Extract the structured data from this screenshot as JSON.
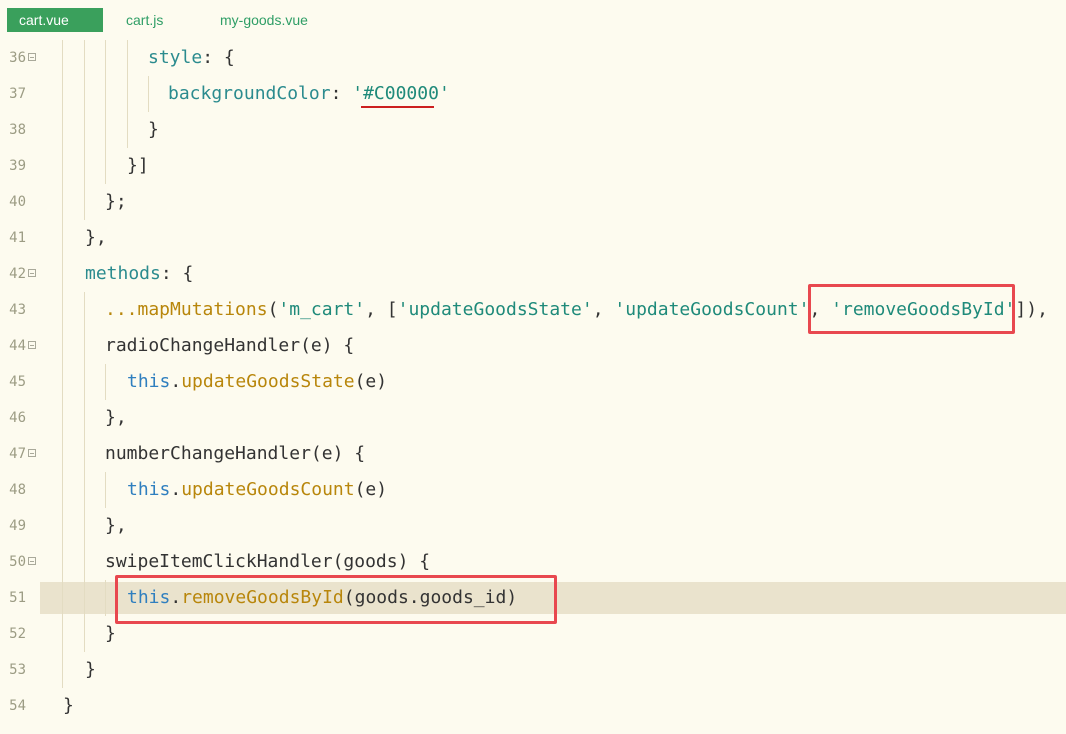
{
  "tabs": [
    {
      "label": "cart.vue",
      "active": true
    },
    {
      "label": "cart.js",
      "active": false
    },
    {
      "label": "my-goods.vue",
      "active": false
    }
  ],
  "colors": {
    "background": "#fdfbef",
    "active_tab": "#3aa05c",
    "highlight_box": "#e8484f",
    "current_line": "#eae3cd"
  },
  "lines": [
    {
      "num": "36",
      "fold": true,
      "tokens": [
        [
          "kw",
          "style"
        ],
        [
          "plain",
          ": {"
        ]
      ]
    },
    {
      "num": "37",
      "fold": false,
      "tokens": [
        [
          "kw",
          "backgroundColor"
        ],
        [
          "plain",
          ": "
        ],
        [
          "str",
          "'#C00000'"
        ]
      ]
    },
    {
      "num": "38",
      "fold": false,
      "tokens": [
        [
          "plain",
          "}"
        ]
      ]
    },
    {
      "num": "39",
      "fold": false,
      "tokens": [
        [
          "plain",
          "}]"
        ]
      ]
    },
    {
      "num": "40",
      "fold": false,
      "tokens": [
        [
          "plain",
          "};"
        ]
      ]
    },
    {
      "num": "41",
      "fold": false,
      "tokens": [
        [
          "plain",
          "},"
        ]
      ]
    },
    {
      "num": "42",
      "fold": true,
      "tokens": [
        [
          "kw",
          "methods"
        ],
        [
          "plain",
          ": {"
        ]
      ]
    },
    {
      "num": "43",
      "fold": false,
      "tokens": [
        [
          "fn",
          "...mapMutations"
        ],
        [
          "plain",
          "("
        ],
        [
          "str",
          "'m_cart'"
        ],
        [
          "plain",
          ", ["
        ],
        [
          "str",
          "'updateGoodsState'"
        ],
        [
          "plain",
          ", "
        ],
        [
          "str",
          "'updateGoodsCount'"
        ],
        [
          "plain",
          ", "
        ],
        [
          "str",
          "'removeGoodsById'"
        ],
        [
          "plain",
          "]),"
        ]
      ]
    },
    {
      "num": "44",
      "fold": true,
      "tokens": [
        [
          "plain",
          "radioChangeHandler(e) {"
        ]
      ]
    },
    {
      "num": "45",
      "fold": false,
      "tokens": [
        [
          "thiskw",
          "this"
        ],
        [
          "plain",
          "."
        ],
        [
          "fn",
          "updateGoodsState"
        ],
        [
          "plain",
          "(e)"
        ]
      ]
    },
    {
      "num": "46",
      "fold": false,
      "tokens": [
        [
          "plain",
          "},"
        ]
      ]
    },
    {
      "num": "47",
      "fold": true,
      "tokens": [
        [
          "plain",
          "numberChangeHandler(e) {"
        ]
      ]
    },
    {
      "num": "48",
      "fold": false,
      "tokens": [
        [
          "thiskw",
          "this"
        ],
        [
          "plain",
          "."
        ],
        [
          "fn",
          "updateGoodsCount"
        ],
        [
          "plain",
          "(e)"
        ]
      ]
    },
    {
      "num": "49",
      "fold": false,
      "tokens": [
        [
          "plain",
          "},"
        ]
      ]
    },
    {
      "num": "50",
      "fold": true,
      "tokens": [
        [
          "plain",
          "swipeItemClickHandler(goods) {"
        ]
      ]
    },
    {
      "num": "51",
      "fold": false,
      "tokens": [
        [
          "thiskw",
          "this"
        ],
        [
          "plain",
          "."
        ],
        [
          "fn",
          "removeGoodsById"
        ],
        [
          "plain",
          "(goods.goods_id)"
        ]
      ]
    },
    {
      "num": "52",
      "fold": false,
      "tokens": [
        [
          "plain",
          "}"
        ]
      ]
    },
    {
      "num": "53",
      "fold": false,
      "tokens": [
        [
          "plain",
          "}"
        ]
      ]
    },
    {
      "num": "54",
      "fold": false,
      "tokens": [
        [
          "plain",
          "}"
        ]
      ]
    }
  ]
}
